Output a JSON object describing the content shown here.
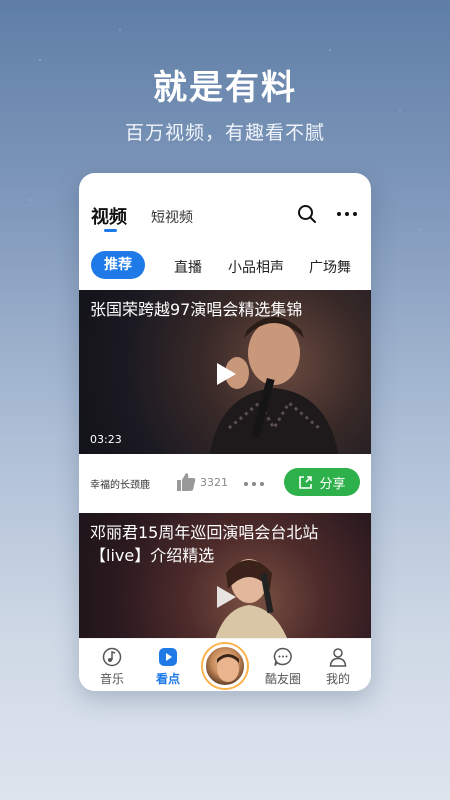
{
  "promo": {
    "title": "就是有料",
    "subtitle": "百万视频，有趣看不腻"
  },
  "header": {
    "tabs": [
      {
        "label": "视频",
        "active": true
      },
      {
        "label": "短视频",
        "active": false
      }
    ]
  },
  "categories": [
    "推荐",
    "直播",
    "小品相声",
    "广场舞"
  ],
  "feed": [
    {
      "title": "张国荣跨越97演唱会精选集锦",
      "duration": "03:23",
      "author": "幸福的长颈鹿",
      "likes": "3321",
      "share_label": "分享"
    },
    {
      "title": "邓丽君15周年巡回演唱会台北站【live】介绍精选"
    }
  ],
  "bottom_nav": [
    {
      "label": "音乐",
      "icon": "music-note-icon",
      "active": false
    },
    {
      "label": "看点",
      "icon": "play-square-icon",
      "active": true
    },
    {
      "label": "",
      "icon": "avatar",
      "active": false
    },
    {
      "label": "酷友圈",
      "icon": "chat-bubble-icon",
      "active": false
    },
    {
      "label": "我的",
      "icon": "user-icon",
      "active": false
    }
  ],
  "colors": {
    "accent": "#1f7ae8",
    "share_green": "#2eb04a"
  }
}
